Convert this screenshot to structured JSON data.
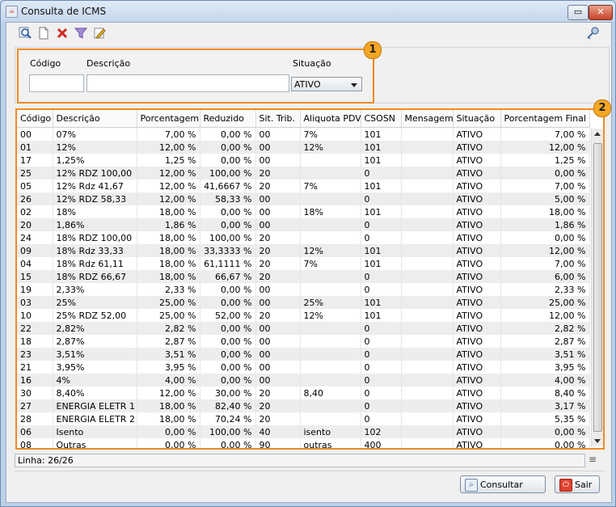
{
  "window": {
    "title": "Consulta de ICMS"
  },
  "toolbar": {
    "icons": [
      "search-icon",
      "new-document-icon",
      "delete-icon",
      "filter-icon",
      "edit-icon",
      "key-icon"
    ]
  },
  "filter": {
    "codigo_label": "Código",
    "codigo_value": "",
    "descricao_label": "Descrição",
    "descricao_value": "",
    "situacao_label": "Situação",
    "situacao_value": "ATIVO"
  },
  "badges": {
    "one": "1",
    "two": "2"
  },
  "table": {
    "headers": [
      "Código",
      "Descrição",
      "Porcentagem",
      "Reduzido",
      "Sit. Trib.",
      "Aliquota PDV",
      "CSOSN",
      "Mensagem",
      "Situação",
      "Porcentagem Final"
    ],
    "rows": [
      [
        "00",
        "07%",
        "7,00 %",
        "0,00 %",
        "00",
        "7%",
        "101",
        "",
        "ATIVO",
        "7,00 %"
      ],
      [
        "01",
        "12%",
        "12,00 %",
        "0,00 %",
        "00",
        "12%",
        "101",
        "",
        "ATIVO",
        "12,00 %"
      ],
      [
        "17",
        "1,25%",
        "1,25 %",
        "0,00 %",
        "00",
        "",
        "101",
        "",
        "ATIVO",
        "1,25 %"
      ],
      [
        "25",
        "12% RDZ 100,00",
        "12,00 %",
        "100,00 %",
        "20",
        "",
        "0",
        "",
        "ATIVO",
        "0,00 %"
      ],
      [
        "05",
        "12%  Rdz 41,67",
        "12,00 %",
        "41,6667 %",
        "20",
        "7%",
        "101",
        "",
        "ATIVO",
        "7,00 %"
      ],
      [
        "26",
        "12% RDZ 58,33",
        "12,00 %",
        "58,33 %",
        "00",
        "",
        "0",
        "",
        "ATIVO",
        "5,00 %"
      ],
      [
        "02",
        "18%",
        "18,00 %",
        "0,00 %",
        "00",
        "18%",
        "101",
        "",
        "ATIVO",
        "18,00 %"
      ],
      [
        "20",
        "1,86%",
        "1,86 %",
        "0,00 %",
        "00",
        "",
        "0",
        "",
        "ATIVO",
        "1,86 %"
      ],
      [
        "24",
        "18% RDZ 100,00",
        "18,00 %",
        "100,00 %",
        "20",
        "",
        "0",
        "",
        "ATIVO",
        "0,00 %"
      ],
      [
        "09",
        "18%  Rdz 33,33",
        "18,00 %",
        "33,3333 %",
        "20",
        "12%",
        "101",
        "",
        "ATIVO",
        "12,00 %"
      ],
      [
        "04",
        "18%  Rdz 61,11",
        "18,00 %",
        "61,1111 %",
        "20",
        "7%",
        "101",
        "",
        "ATIVO",
        "7,00 %"
      ],
      [
        "15",
        "18% RDZ 66,67",
        "18,00 %",
        "66,67 %",
        "20",
        "",
        "0",
        "",
        "ATIVO",
        "6,00 %"
      ],
      [
        "19",
        "2,33%",
        "2,33 %",
        "0,00 %",
        "00",
        "",
        "0",
        "",
        "ATIVO",
        "2,33 %"
      ],
      [
        "03",
        "25%",
        "25,00 %",
        "0,00 %",
        "00",
        "25%",
        "101",
        "",
        "ATIVO",
        "25,00 %"
      ],
      [
        "10",
        "25%  RDZ 52,00",
        "25,00 %",
        "52,00 %",
        "20",
        "12%",
        "101",
        "",
        "ATIVO",
        "12,00 %"
      ],
      [
        "22",
        "2,82%",
        "2,82 %",
        "0,00 %",
        "00",
        "",
        "0",
        "",
        "ATIVO",
        "2,82 %"
      ],
      [
        "18",
        "2,87%",
        "2,87 %",
        "0,00 %",
        "00",
        "",
        "0",
        "",
        "ATIVO",
        "2,87 %"
      ],
      [
        "23",
        "3,51%",
        "3,51 %",
        "0,00 %",
        "00",
        "",
        "0",
        "",
        "ATIVO",
        "3,51 %"
      ],
      [
        "21",
        "3,95%",
        "3,95 %",
        "0,00 %",
        "00",
        "",
        "0",
        "",
        "ATIVO",
        "3,95 %"
      ],
      [
        "16",
        "4%",
        "4,00 %",
        "0,00 %",
        "00",
        "",
        "0",
        "",
        "ATIVO",
        "4,00 %"
      ],
      [
        "30",
        "8,40%",
        "12,00 %",
        "30,00 %",
        "20",
        "8,40",
        "0",
        "",
        "ATIVO",
        "8,40 %"
      ],
      [
        "27",
        "ENERGIA ELETR 1",
        "18,00 %",
        "82,40 %",
        "20",
        "",
        "0",
        "",
        "ATIVO",
        "3,17 %"
      ],
      [
        "28",
        "ENERGIA ELETR 2",
        "18,00 %",
        "70,24 %",
        "20",
        "",
        "0",
        "",
        "ATIVO",
        "5,35 %"
      ],
      [
        "06",
        "Isento",
        "0,00 %",
        "100,00 %",
        "40",
        "isento",
        "102",
        "",
        "ATIVO",
        "0,00 %"
      ],
      [
        "08",
        "Outras",
        "0,00 %",
        "0,00 %",
        "90",
        "outras",
        "400",
        "",
        "ATIVO",
        "0,00 %"
      ]
    ]
  },
  "status": {
    "line_text": "Linha: 26/26"
  },
  "buttons": {
    "consultar": "Consultar",
    "sair": "Sair"
  }
}
